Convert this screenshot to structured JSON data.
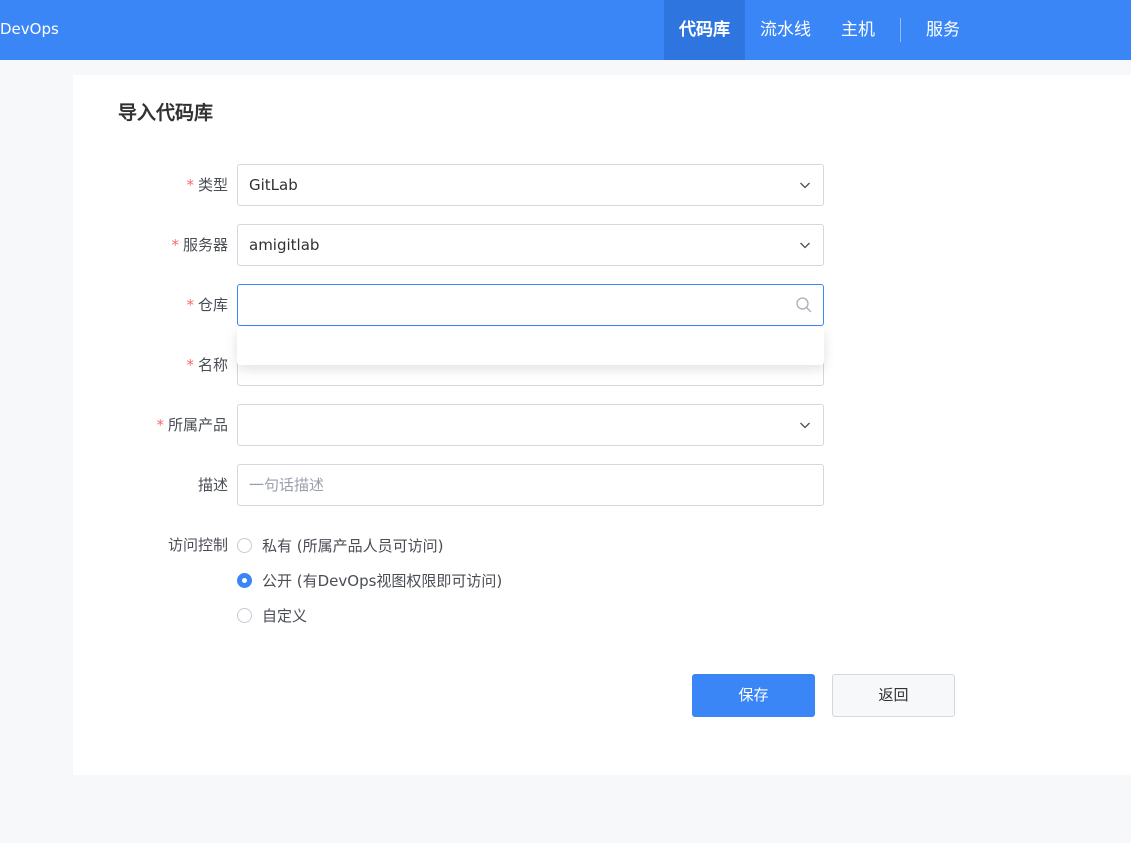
{
  "header": {
    "brand": "DevOps",
    "nav": [
      {
        "label": "代码库",
        "active": true
      },
      {
        "label": "流水线",
        "active": false
      },
      {
        "label": "主机",
        "active": false
      },
      {
        "label": "服务",
        "active": false
      }
    ],
    "color": "#3a86f7",
    "active_color": "#2f75df"
  },
  "form": {
    "title": "导入代码库",
    "required_mark": "*",
    "fields": {
      "type": {
        "label": "类型",
        "value": "GitLab",
        "icon": "chevron-down-icon"
      },
      "server": {
        "label": "服务器",
        "value": "amigitlab",
        "icon": "chevron-down-icon"
      },
      "repo": {
        "label": "仓库",
        "value": "",
        "icon": "search-icon"
      },
      "name": {
        "label": "名称",
        "value": ""
      },
      "product": {
        "label": "所属产品",
        "value": "",
        "icon": "chevron-down-icon"
      },
      "desc": {
        "label": "描述",
        "placeholder": "一句话描述"
      }
    },
    "access": {
      "label": "访问控制",
      "options": [
        {
          "label": "私有 (所属产品人员可访问)",
          "checked": false
        },
        {
          "label": "公开 (有DevOps视图权限即可访问)",
          "checked": true
        },
        {
          "label": "自定义",
          "checked": false
        }
      ]
    },
    "buttons": {
      "save": "保存",
      "back": "返回"
    }
  }
}
